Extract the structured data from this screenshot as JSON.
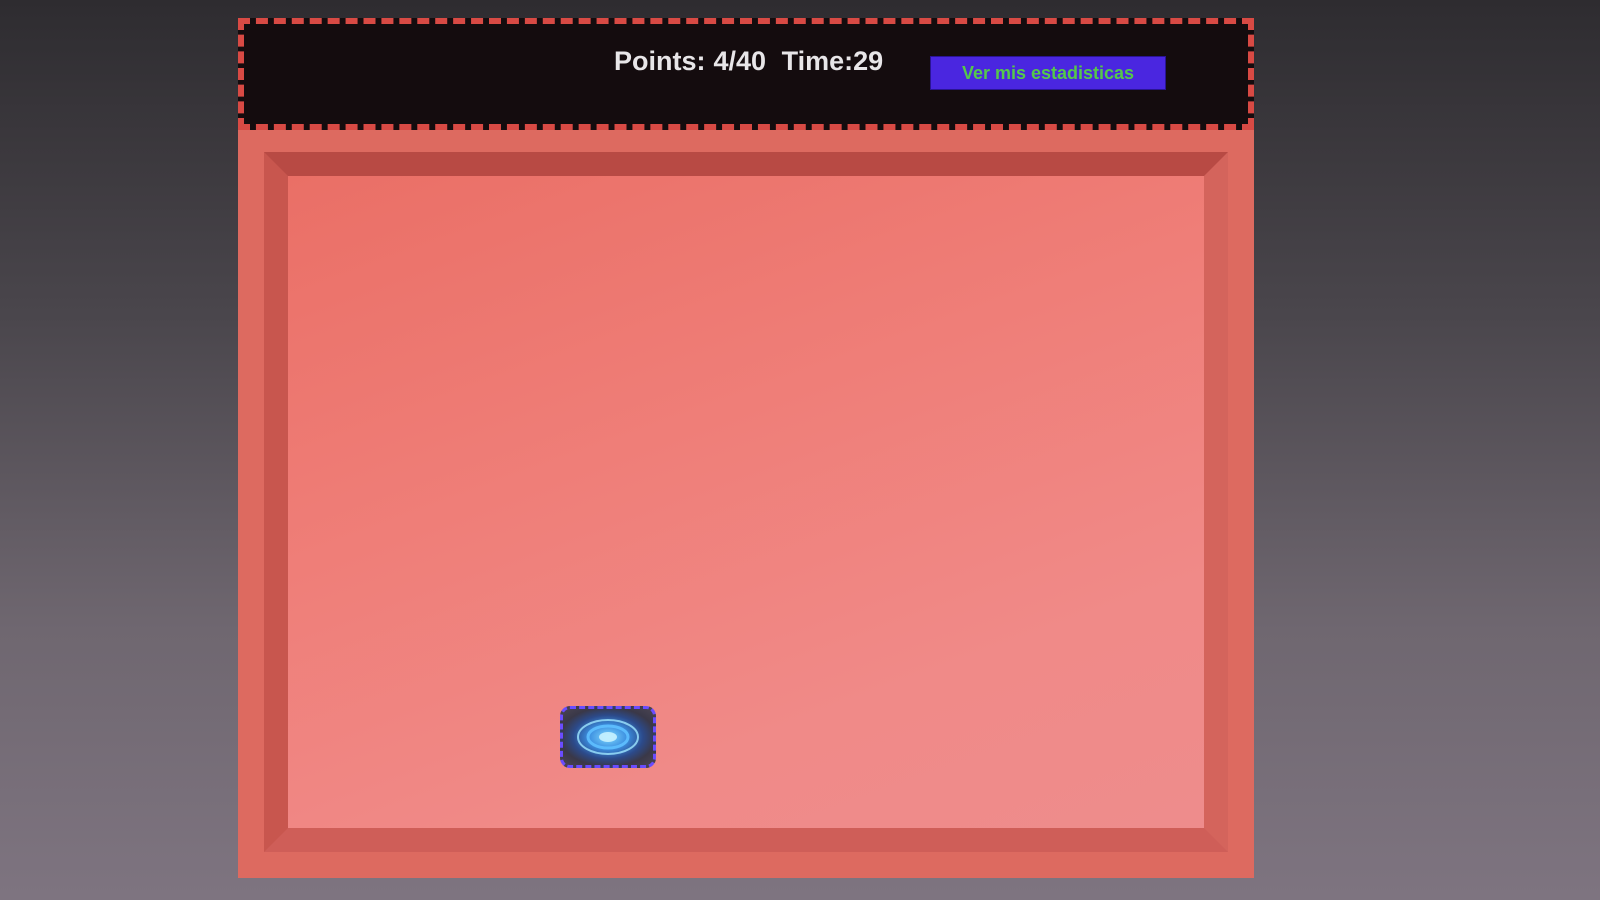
{
  "hud": {
    "points_label": "Points:",
    "points_value": "4/40",
    "time_label": "Time:",
    "time_value": "29",
    "stats_button_label": "Ver mis estadisticas"
  },
  "board": {
    "target_icon": "glowing-target-icon"
  },
  "colors": {
    "hud_background": "#140c0e",
    "hud_border": "#d84a44",
    "board_background": "#ef7e78",
    "button_background": "#4a26e0",
    "button_text": "#55c84a",
    "target_glow": "#7fd8ff"
  }
}
